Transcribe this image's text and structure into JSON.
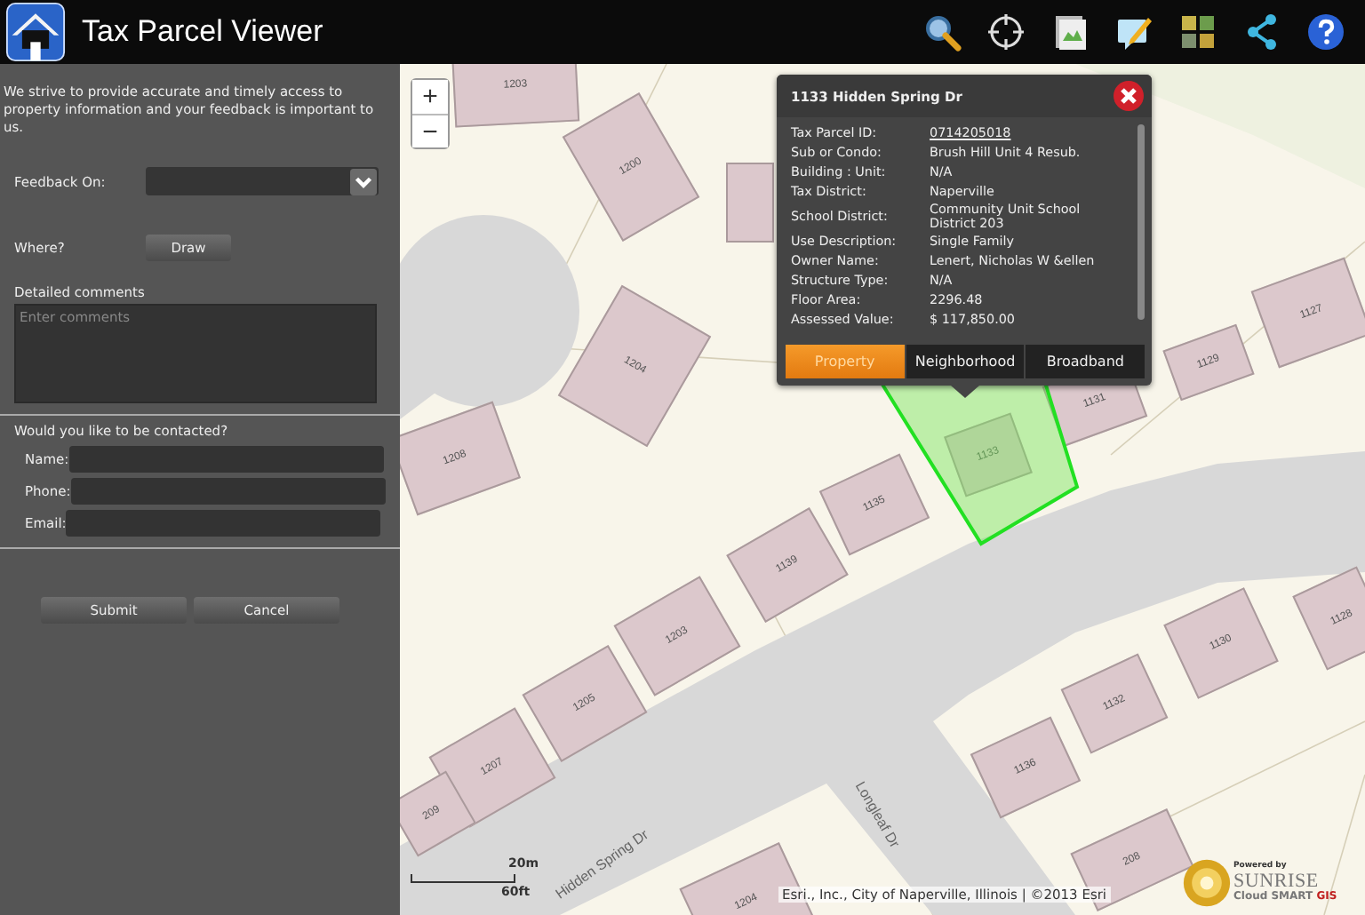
{
  "app": {
    "title": "Tax Parcel Viewer"
  },
  "toolbar": [
    {
      "kind": "search"
    },
    {
      "kind": "locate"
    },
    {
      "kind": "gallery"
    },
    {
      "kind": "note"
    },
    {
      "kind": "grid"
    },
    {
      "kind": "share"
    },
    {
      "kind": "help"
    }
  ],
  "feedback": {
    "intro": "We strive to provide accurate and timely access to property information and your feedback is important to us.",
    "feedback_on_label": "Feedback On:",
    "where_label": "Where?",
    "draw_button": "Draw",
    "comments_label": "Detailed comments",
    "comments_placeholder": "Enter comments",
    "contact_heading": "Would you like to be contacted?",
    "contact_fields": [
      {
        "label": "Name:"
      },
      {
        "label": "Phone:"
      },
      {
        "label": "Email:"
      }
    ],
    "buttons": [
      "Submit",
      "Cancel"
    ]
  },
  "map": {
    "zoom_in": "+",
    "zoom_out": "−",
    "parcels": [
      "1203",
      "1200",
      "1204",
      "1208",
      "1127",
      "1129",
      "1131",
      "1133",
      "1135",
      "1139",
      "1203",
      "1205",
      "1207",
      "1130",
      "1132",
      "1136",
      "1128",
      "209",
      "1204",
      "208"
    ],
    "roads": [
      "Hidden Spring Dr",
      "Longleaf Dr"
    ],
    "scale": {
      "metric": "20m",
      "imperial": "60ft"
    },
    "attribution": "Esri., Inc., City of Naperville, Illinois | ©2013 Esri",
    "branding": {
      "powered_by": "Powered by",
      "name": "SUNRISE",
      "tagline": "Cloud SMART",
      "tagline_bold": "GIS"
    }
  },
  "popup": {
    "title": "1133 Hidden Spring Dr",
    "rows": [
      {
        "label": "Tax Parcel ID:",
        "value": "0714205018",
        "kind": "link"
      },
      {
        "label": "Sub or Condo:",
        "value": "Brush Hill Unit 4 Resub.",
        "kind": "text"
      },
      {
        "label": "Building : Unit:",
        "value": "N/A",
        "kind": "text"
      },
      {
        "label": "Tax District:",
        "value": "Naperville",
        "kind": "text"
      },
      {
        "label": "School District:",
        "value": "Community Unit School District 203",
        "kind": "text"
      },
      {
        "label": "Use Description:",
        "value": "Single Family",
        "kind": "text"
      },
      {
        "label": "Owner Name:",
        "value": "Lenert, Nicholas W &ellen",
        "kind": "text"
      },
      {
        "label": "Structure Type:",
        "value": "N/A",
        "kind": "text"
      },
      {
        "label": "Floor Area:",
        "value": "2296.48",
        "kind": "text"
      },
      {
        "label": "Assessed Value:",
        "value": "$ 117,850.00",
        "kind": "text"
      }
    ],
    "tabs": [
      {
        "label": "Property",
        "selected": true
      },
      {
        "label": "Neighborhood",
        "selected": false
      },
      {
        "label": "Broadband",
        "selected": false
      }
    ]
  }
}
